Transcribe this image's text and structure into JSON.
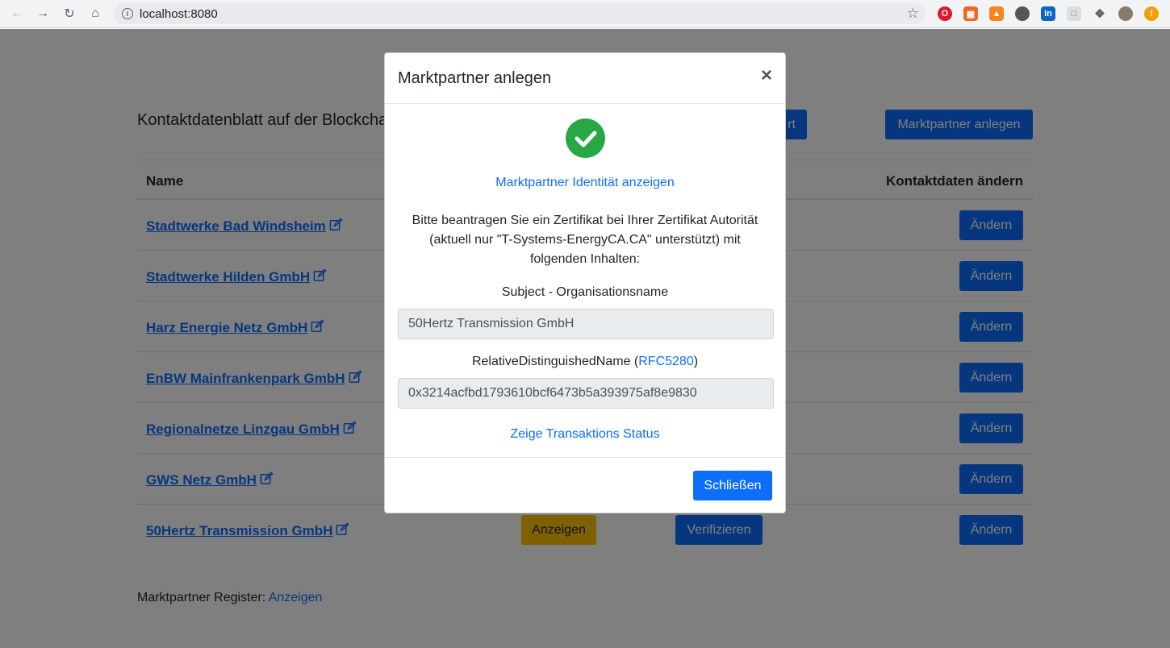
{
  "browser": {
    "url": "localhost:8080"
  },
  "page": {
    "title": "Kontaktdatenblatt auf der Blockchain",
    "top_buttons": {
      "partial_label": "rt",
      "create_label": "Marktpartner anlegen"
    },
    "table": {
      "headers": {
        "name": "Name",
        "change": "Kontaktdaten ändern"
      },
      "rows": [
        {
          "name": "Stadtwerke Bad Windsheim",
          "change": "Ändern"
        },
        {
          "name": "Stadtwerke Hilden GmbH",
          "change": "Ändern"
        },
        {
          "name": "Harz Energie Netz GmbH",
          "change": "Ändern"
        },
        {
          "name": "EnBW Mainfrankenpark GmbH",
          "change": "Ändern"
        },
        {
          "name": "Regionalnetze Linzgau GmbH",
          "change": "Ändern"
        },
        {
          "name": "GWS Netz GmbH",
          "change": "Ändern"
        },
        {
          "name": "50Hertz Transmission GmbH",
          "show": "Anzeigen",
          "verify": "Verifizieren",
          "change": "Ändern"
        }
      ]
    },
    "register": {
      "label": "Marktpartner Register:",
      "link": "Anzeigen"
    }
  },
  "modal": {
    "title": "Marktpartner anlegen",
    "close_symbol": "×",
    "identity_link": "Marktpartner Identität anzeigen",
    "instructions": "Bitte beantragen Sie ein Zertifikat bei Ihrer Zertifikat Autorität (aktuell nur \"T-Systems-EnergyCA.CA\" unterstützt) mit folgenden Inhalten:",
    "subject_label": "Subject - Organisationsname",
    "subject_value": "50Hertz Transmission GmbH",
    "rdn_label_prefix": "RelativeDistinguishedName (",
    "rdn_label_link": "RFC5280",
    "rdn_label_suffix": ")",
    "rdn_value": "0x3214acfbd1793610bcf6473b5a393975af8e9830",
    "status_link": "Zeige Transaktions Status",
    "close_button": "Schließen"
  },
  "colors": {
    "primary": "#0d6efd",
    "warning": "#ffc107",
    "success": "#28a745"
  }
}
